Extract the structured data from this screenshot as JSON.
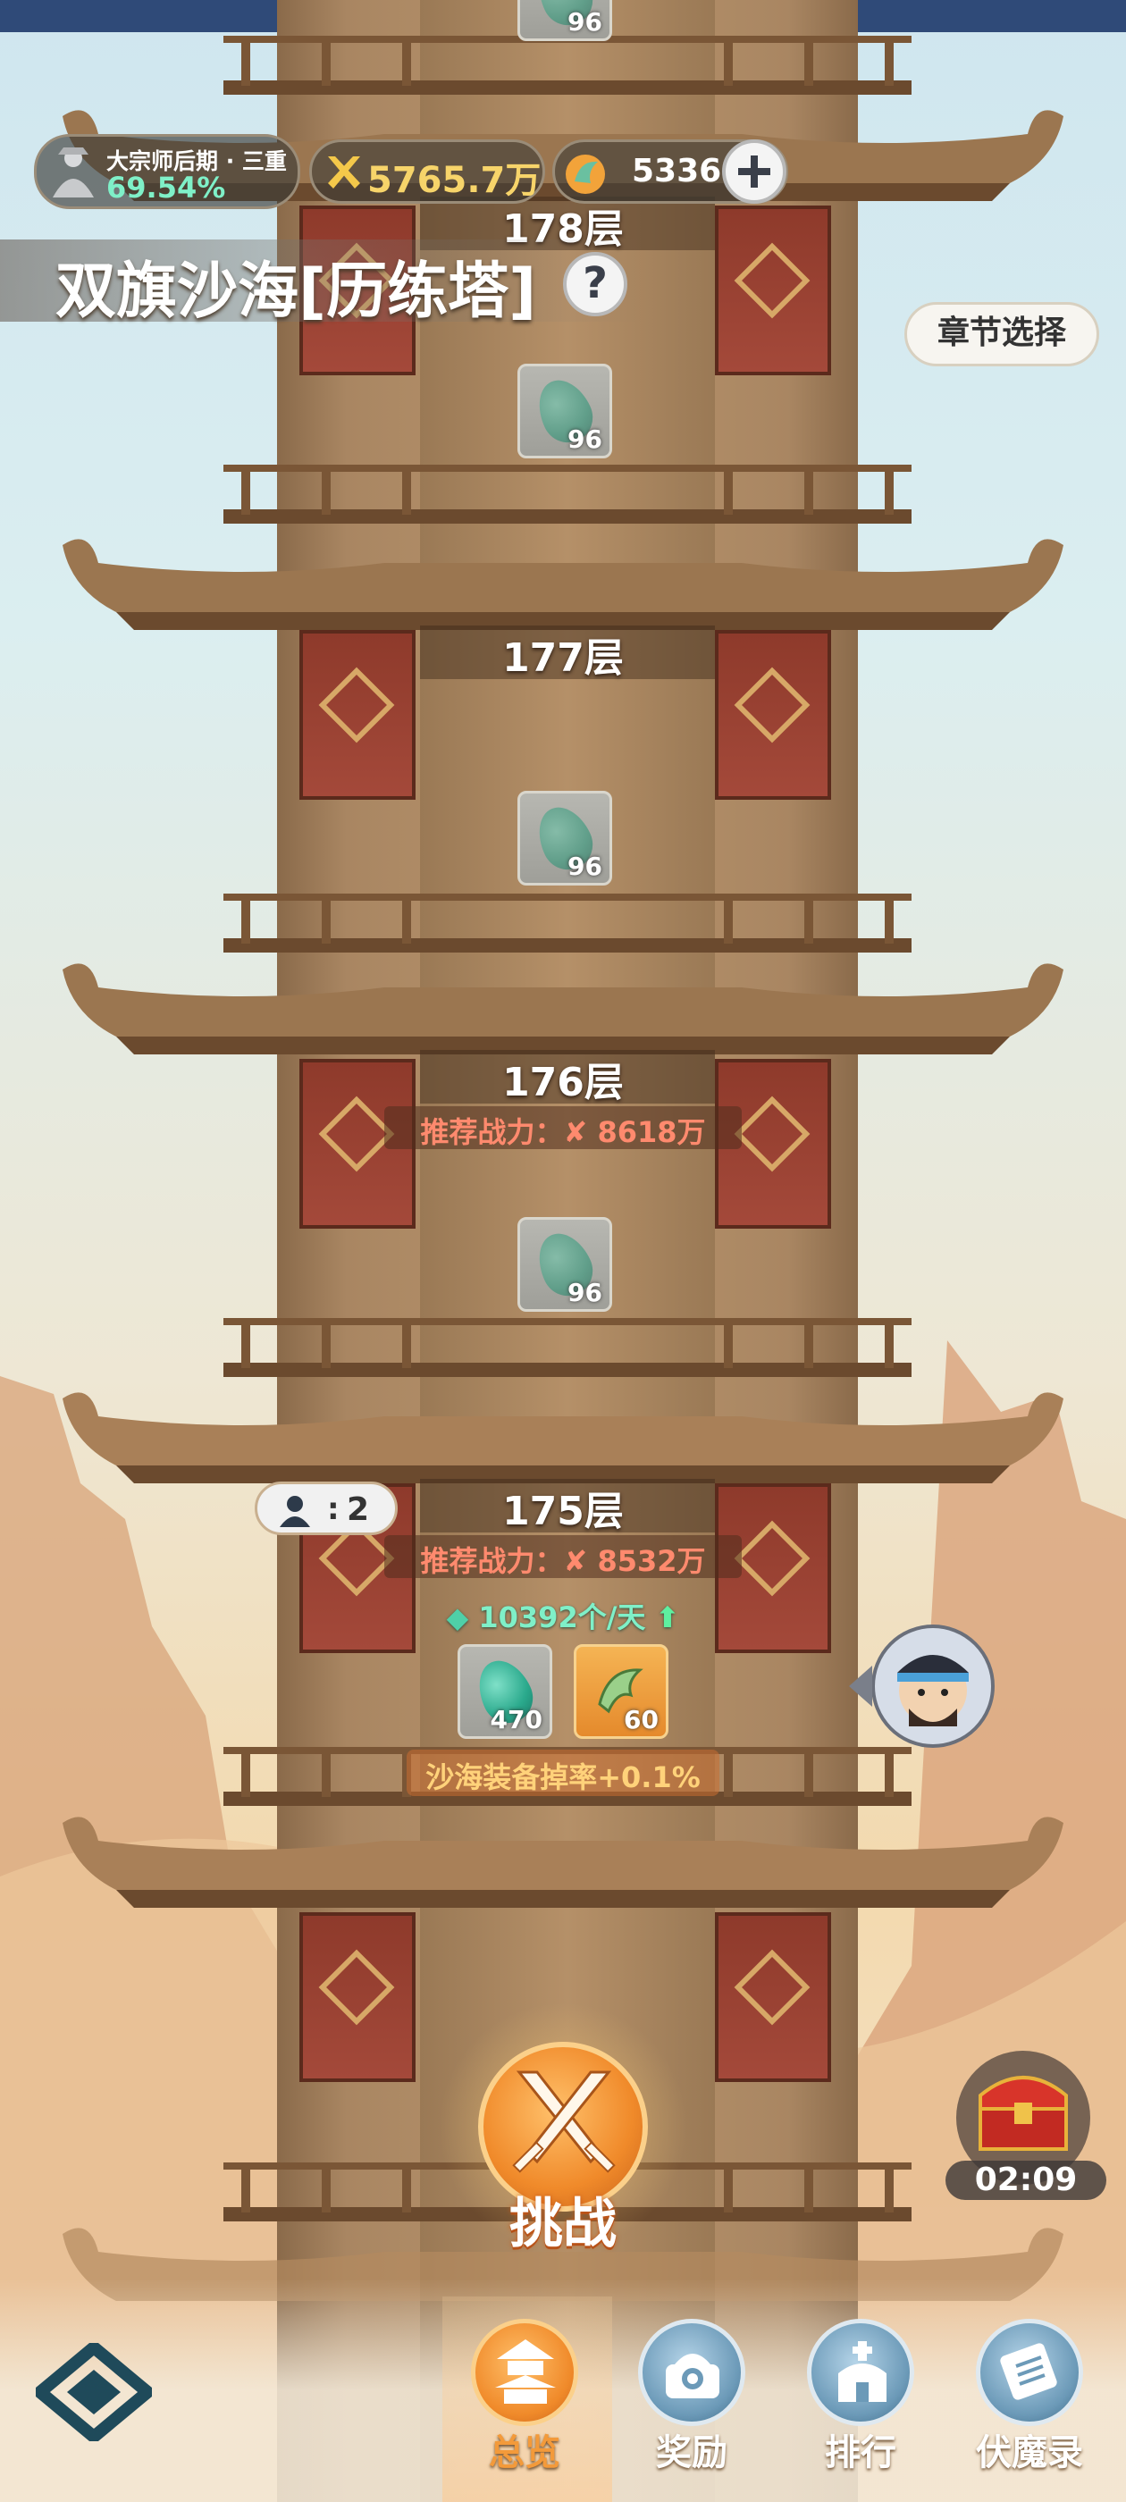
{
  "player": {
    "realm": "大宗师后期 · 三重",
    "progress": "69.54%",
    "power": "5765.7万",
    "currency": "5336"
  },
  "tower": {
    "title": "双旗沙海[历练塔]",
    "chapter_button": "章节选择",
    "help": "?"
  },
  "floors": [
    {
      "label": "178层",
      "item_count": "96"
    },
    {
      "label": "177层",
      "item_count": "96"
    },
    {
      "label": "176层",
      "recommended": "推荐战力：",
      "recommended_value": "8618万",
      "item_count": "96"
    },
    {
      "label": "175层",
      "recommended": "推荐战力：",
      "recommended_value": "8532万",
      "rate": "10392个/天",
      "rewards": [
        "470",
        "60"
      ],
      "bonus": "沙海装备掉率+0.1%",
      "players": "2",
      "players_sep": ":"
    }
  ],
  "top_item_count": "96",
  "challenge": "挑战",
  "chest_timer": "02:09",
  "nav": {
    "items": [
      "总览",
      "奖励",
      "排行",
      "伏魔录"
    ],
    "active": "总览"
  },
  "colors": {
    "accent": "#f39a3a",
    "recommended": "#ff8a6e",
    "rate": "#7ff0c8",
    "topbar": "#2f4a78"
  }
}
